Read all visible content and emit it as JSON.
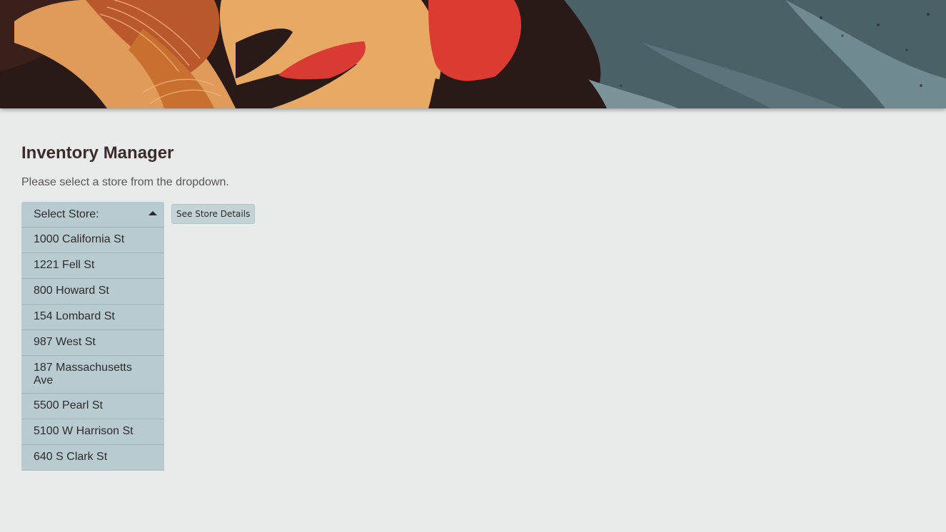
{
  "header": {
    "banner_name": "decorative-banner"
  },
  "page": {
    "title": "Inventory Manager",
    "instruction": "Please select a store from the dropdown."
  },
  "store_select": {
    "label": "Select Store:",
    "expanded": true,
    "options": [
      "1000 California St",
      "1221 Fell St",
      "800 Howard St",
      "154 Lombard St",
      "987 West St",
      "187 Massachusetts Ave",
      "5500 Pearl St",
      "5100 W Harrison St",
      "640 S Clark St"
    ]
  },
  "buttons": {
    "details_label": "See Store Details"
  },
  "colors": {
    "background": "#e9ebea",
    "dropdown": "#b7cbd0",
    "title_text": "#3b2b2b"
  }
}
